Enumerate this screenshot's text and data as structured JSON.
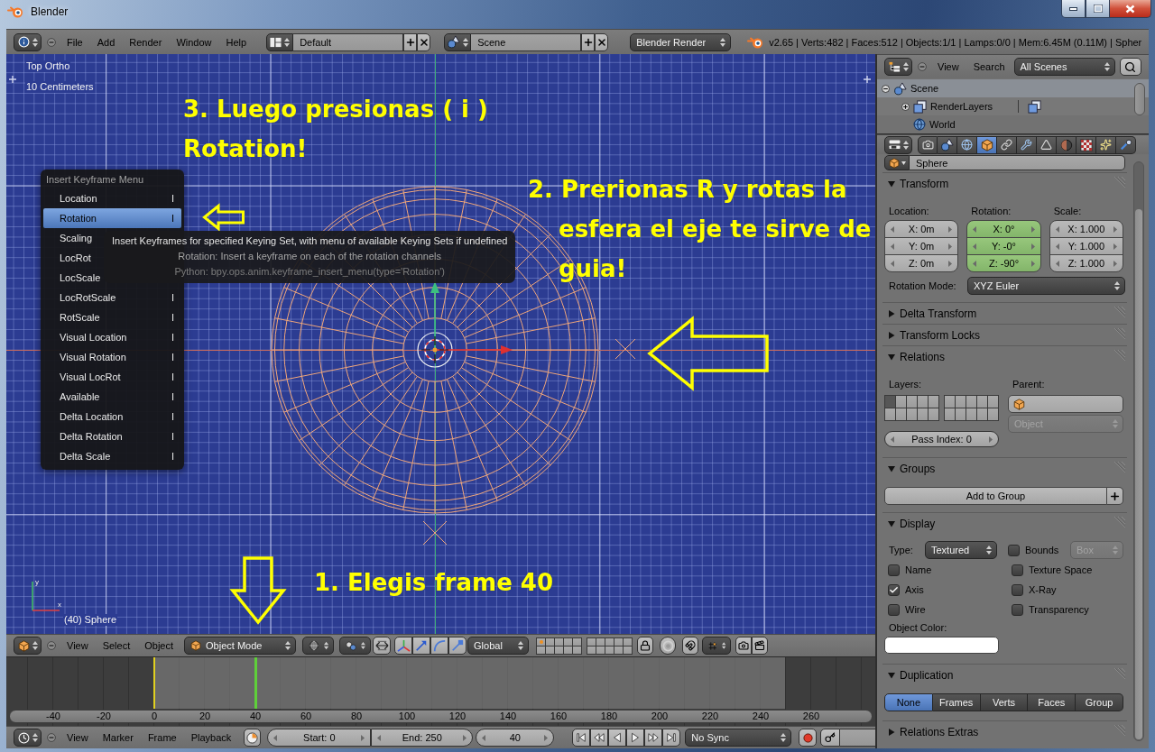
{
  "window": {
    "title": "Blender"
  },
  "info_header": {
    "menus": [
      "File",
      "Add",
      "Render",
      "Window",
      "Help"
    ],
    "screen_layout": "Default",
    "scene": "Scene",
    "render_engine": "Blender Render",
    "stats": "v2.65 | Verts:482 | Faces:512 | Objects:1/1 | Lamps:0/0 | Mem:6.45M (0.11M) | Spher"
  },
  "viewport": {
    "view_name": "Top Ortho",
    "grid_scale": "10 Centimeters",
    "object_info": "(40) Sphere",
    "axis_labels": [
      "y",
      "x"
    ],
    "annotations": [
      {
        "kind": "plain",
        "lines": [
          "3. Luego presionas ( i )",
          "Rotation!"
        ]
      },
      {
        "kind": "hanging",
        "lines": [
          "2. Prerionas R y rotas la",
          "esfera el eje te sirve de",
          "guia!"
        ]
      },
      {
        "kind": "plain",
        "lines": [
          "1. Elegis frame 40"
        ]
      }
    ],
    "keyframe_menu": {
      "title": "Insert Keyframe Menu",
      "items": [
        {
          "label": "Location",
          "shortcut": "I",
          "selected": false
        },
        {
          "label": "Rotation",
          "shortcut": "I",
          "selected": true
        },
        {
          "label": "Scaling",
          "selected": false
        },
        {
          "label": "LocRot",
          "selected": false
        },
        {
          "label": "LocScale",
          "selected": false
        },
        {
          "label": "LocRotScale",
          "shortcut": "I",
          "selected": false
        },
        {
          "label": "RotScale",
          "shortcut": "I",
          "selected": false
        },
        {
          "label": "Visual Location",
          "shortcut": "I",
          "selected": false
        },
        {
          "label": "Visual Rotation",
          "shortcut": "I",
          "selected": false
        },
        {
          "label": "Visual LocRot",
          "shortcut": "I",
          "selected": false
        },
        {
          "label": "Available",
          "shortcut": "I",
          "selected": false
        },
        {
          "label": "Delta Location",
          "shortcut": "I",
          "selected": false
        },
        {
          "label": "Delta Rotation",
          "shortcut": "I",
          "selected": false
        },
        {
          "label": "Delta Scale",
          "shortcut": "I",
          "selected": false
        }
      ]
    },
    "tooltip": {
      "lines": [
        "Insert Keyframes for specified Keying Set, with menu of available Keying Sets if undefined",
        "Rotation: Insert a keyframe on each of the rotation channels",
        "Python: bpy.ops.anim.keyframe_insert_menu(type='Rotation')"
      ]
    }
  },
  "viewport_header": {
    "menus": [
      "View",
      "Select",
      "Object"
    ],
    "mode": "Object Mode",
    "orientation": "Global",
    "layers": [
      {
        "has_object": true
      },
      {
        "has_object": false
      },
      {
        "has_object": false
      },
      {
        "has_object": false
      },
      {
        "has_object": false
      },
      {
        "has_object": false
      },
      {
        "has_object": false
      },
      {
        "has_object": false
      },
      {
        "has_object": false
      },
      {
        "has_object": false
      },
      {
        "has_object": false
      },
      {
        "has_object": false
      },
      {
        "has_object": false
      },
      {
        "has_object": false
      },
      {
        "has_object": false
      },
      {
        "has_object": false
      },
      {
        "has_object": false
      },
      {
        "has_object": false
      },
      {
        "has_object": false
      },
      {
        "has_object": false
      }
    ]
  },
  "timeline": {
    "ruler": [
      "-40",
      "-20",
      "0",
      "20",
      "40",
      "60",
      "80",
      "100",
      "120",
      "140",
      "160",
      "180",
      "200",
      "220",
      "240",
      "260"
    ],
    "playhead": {
      "level": 0.286
    }
  },
  "timeline_header": {
    "menus": [
      "View",
      "Marker",
      "Frame",
      "Playback"
    ],
    "start": "Start: 0",
    "end": "End: 250",
    "current_frame": "40",
    "sync": "No Sync"
  },
  "outliner": {
    "menus": [
      "View",
      "Search"
    ],
    "filter": "All Scenes",
    "tree": [
      {
        "label": "Scene",
        "expanded": true,
        "selected": true,
        "children": [
          {
            "label": "RenderLayers",
            "expanded": false,
            "selected": false
          },
          {
            "label": "World",
            "selected": false
          }
        ]
      }
    ]
  },
  "properties": {
    "tabs": [
      {
        "selected": false
      },
      {
        "selected": false
      },
      {
        "selected": false
      },
      {
        "selected": true
      },
      {
        "selected": false
      },
      {
        "selected": false
      },
      {
        "selected": false
      },
      {
        "selected": false
      },
      {
        "selected": false
      },
      {
        "selected": false
      },
      {
        "selected": false
      }
    ],
    "object_name": "Sphere",
    "panels": [
      {
        "kind": "transform",
        "title": "Transform",
        "expanded": true,
        "groups": [
          {
            "label": "Location:",
            "keyed": false,
            "fields": [
              "X: 0m",
              "Y: 0m",
              "Z: 0m"
            ]
          },
          {
            "label": "Rotation:",
            "keyed": true,
            "fields": [
              "X: 0°",
              "Y: -0°",
              "Z: -90°"
            ]
          },
          {
            "label": "Scale:",
            "keyed": false,
            "fields": [
              "X: 1.000",
              "Y: 1.000",
              "Z: 1.000"
            ]
          }
        ],
        "mode_label": "Rotation Mode:",
        "mode": "XYZ Euler"
      },
      {
        "kind": "header",
        "title": "Delta Transform",
        "expanded": false
      },
      {
        "kind": "header",
        "title": "Transform Locks",
        "expanded": false
      },
      {
        "kind": "relations",
        "title": "Relations",
        "expanded": true,
        "layers_label": "Layers:",
        "layers": [
          {
            "selected": true
          },
          {
            "selected": false
          },
          {
            "selected": false
          },
          {
            "selected": false
          },
          {
            "selected": false
          },
          {
            "selected": false
          },
          {
            "selected": false
          },
          {
            "selected": false
          },
          {
            "selected": false
          },
          {
            "selected": false
          },
          {
            "selected": false
          },
          {
            "selected": false
          },
          {
            "selected": false
          },
          {
            "selected": false
          },
          {
            "selected": false
          },
          {
            "selected": false
          },
          {
            "selected": false
          },
          {
            "selected": false
          },
          {
            "selected": false
          },
          {
            "selected": false
          }
        ],
        "parent_label": "Parent:",
        "parent_type": {
          "value": "Object",
          "disabled": true
        },
        "pass_index": "Pass Index: 0"
      },
      {
        "kind": "groups",
        "title": "Groups",
        "expanded": true,
        "button": "Add to Group"
      },
      {
        "kind": "display",
        "title": "Display",
        "expanded": true,
        "type_label": "Type:",
        "type": "Textured",
        "bounds": {
          "label": "Bounds",
          "checked": false
        },
        "bounds_type": {
          "value": "Box",
          "disabled": true
        },
        "options": [
          {
            "label": "Name",
            "checked": false
          },
          {
            "label": "Texture Space",
            "checked": false
          },
          {
            "label": "Axis",
            "checked": true
          },
          {
            "label": "X-Ray",
            "checked": false
          },
          {
            "label": "Wire",
            "checked": false
          },
          {
            "label": "Transparency",
            "checked": false
          }
        ],
        "color_label": "Object Color:",
        "color": "#ffffff"
      },
      {
        "kind": "duplication",
        "title": "Duplication",
        "expanded": true,
        "options": [
          {
            "label": "None",
            "selected": true
          },
          {
            "label": "Frames",
            "selected": false
          },
          {
            "label": "Verts",
            "selected": false
          },
          {
            "label": "Faces",
            "selected": false
          },
          {
            "label": "Group",
            "selected": false
          }
        ]
      },
      {
        "kind": "header",
        "title": "Relations Extras",
        "expanded": false
      }
    ]
  }
}
